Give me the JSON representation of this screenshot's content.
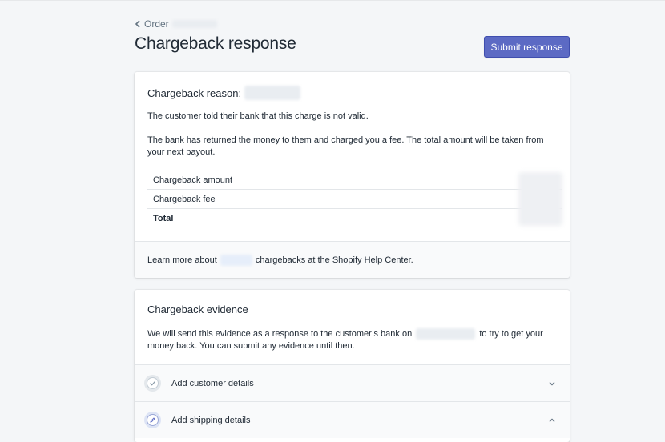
{
  "breadcrumb": {
    "label": "Order"
  },
  "header": {
    "title": "Chargeback response",
    "submit_label": "Submit response"
  },
  "reason_card": {
    "title": "Chargeback reason:",
    "description": "The customer told their bank that this charge is not valid.",
    "notice": "The bank has returned the money to them and charged you a fee. The total amount will be taken from your next payout.",
    "rows": [
      {
        "label": "Chargeback amount"
      },
      {
        "label": "Chargeback fee"
      },
      {
        "label": "Total"
      }
    ],
    "footer_prefix": "Learn more about",
    "footer_suffix": "chargebacks at the Shopify Help Center."
  },
  "evidence_card": {
    "title": "Chargeback evidence",
    "text_prefix": "We will send this evidence as a response to the customer’s bank on",
    "text_suffix_line1": "to try to get your",
    "text_line2": "money back. You can submit any evidence until then.",
    "sections": [
      {
        "label": "Add customer details",
        "icon": "check-circle-icon",
        "expanded": false
      },
      {
        "label": "Add shipping details",
        "icon": "pencil-circle-icon",
        "expanded": true
      }
    ]
  }
}
